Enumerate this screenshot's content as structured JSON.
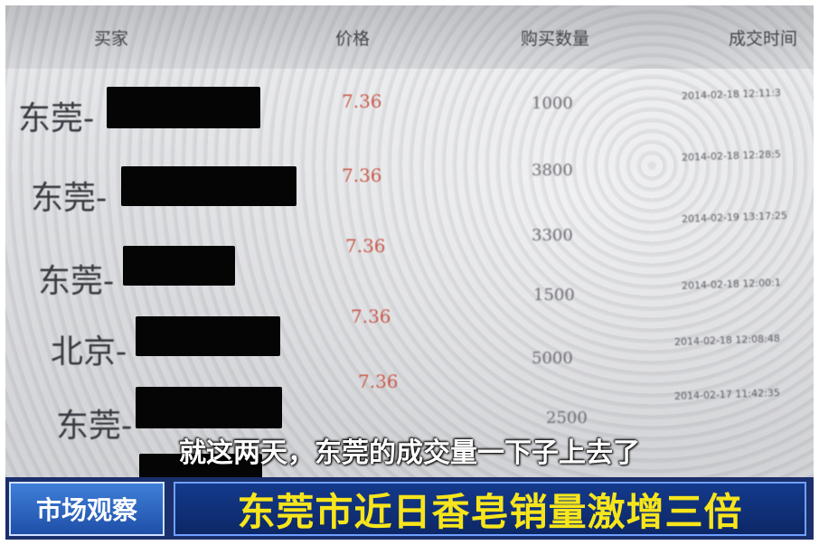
{
  "table": {
    "headers": [
      "买家",
      "价格",
      "购买数量",
      "成交时间"
    ],
    "rows": [
      {
        "buyer": "东莞-",
        "price": "7.36",
        "qty": "1000",
        "time": "2014-02-18 12:11:3"
      },
      {
        "buyer": "东莞-",
        "price": "7.36",
        "qty": "3800",
        "time": "2014-02-18 12:28:5"
      },
      {
        "buyer": "东莞-",
        "price": "7.36",
        "qty": "3300",
        "time": "2014-02-19 13:17:25"
      },
      {
        "buyer": "北京-",
        "price": "7.36",
        "qty": "1500",
        "time": "2014-02-18 12:00:1"
      },
      {
        "buyer": "东莞-",
        "price": "7.36",
        "qty": "5000",
        "time": "2014-02-18 12:08:48"
      },
      {
        "buyer": "东莞-",
        "price": "",
        "qty": "2500",
        "time": "2014-02-17 11:42:35"
      }
    ]
  },
  "subtitle": "就这两天，东莞的成交量一下子上去了",
  "lower_third": {
    "tag": "市场观察",
    "headline": "东莞市近日香皂销量激增三倍"
  },
  "colors": {
    "price_red": "#c95a4a",
    "headline_yellow": "#f7e51c",
    "lower_third_blue": "#1a2f6b",
    "tag_blue": "#3f7fd8"
  }
}
